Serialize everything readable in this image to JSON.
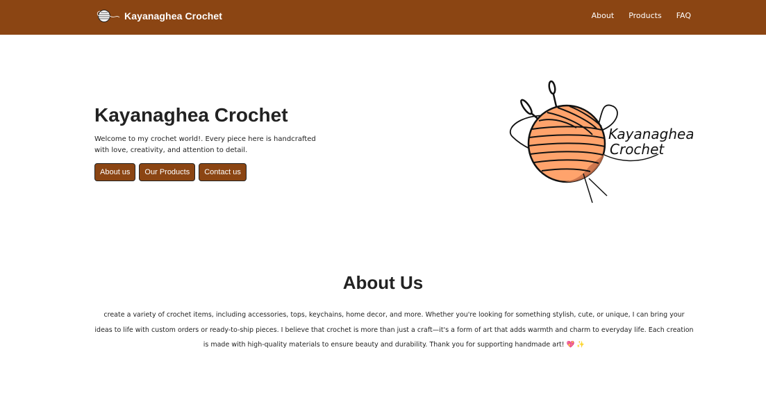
{
  "navbar": {
    "brand_name": "Kayanaghea Crochet",
    "links": [
      {
        "label": "About"
      },
      {
        "label": "Products"
      },
      {
        "label": "FAQ"
      }
    ]
  },
  "hero": {
    "title": "Kayanaghea Crochet",
    "text": "Welcome to my crochet world!. Every piece here is handcrafted with love, creativity, and attention to detail.",
    "buttons": [
      {
        "label": "About us"
      },
      {
        "label": "Our Products"
      },
      {
        "label": "Contact us"
      }
    ],
    "logo_text_line1": "Kayanaghea",
    "logo_text_line2": "Crochet"
  },
  "about": {
    "title": "About Us",
    "text": "create a variety of crochet items, including accessories, tops, keychains, home decor, and more. Whether you're looking for something stylish, cute, or unique, I can bring your ideas to life with custom orders or ready-to-ship pieces. I believe that crochet is more than just a craft—it's a form of art that adds warmth and charm to everyday life. Each creation is made with high-quality materials to ensure beauty and durability. Thank you for supporting handmade art! 💖 ✨"
  },
  "colors": {
    "navbar_bg": "#8b4513",
    "button_bg": "#8b4513",
    "yarn_ball": "#ffa36c",
    "text": "#222222"
  }
}
